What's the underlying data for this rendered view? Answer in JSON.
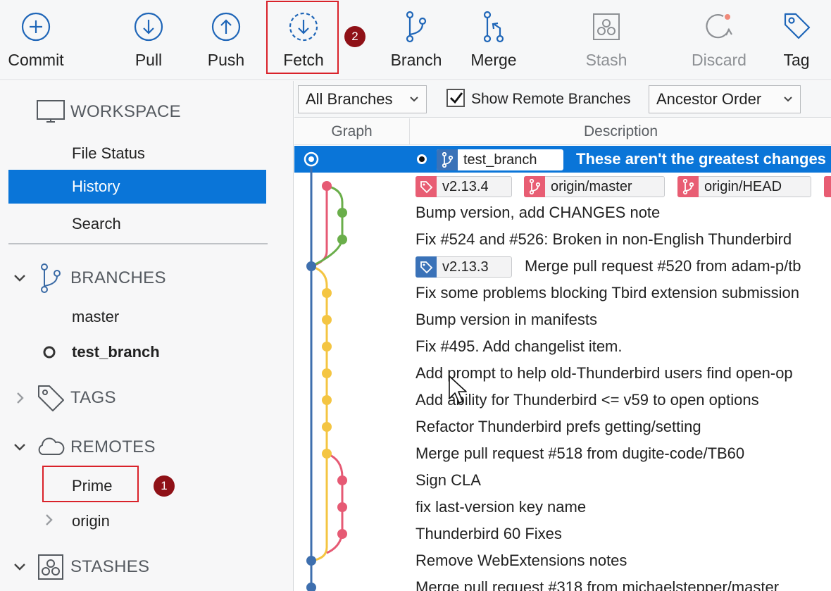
{
  "toolbar": {
    "buttons": [
      {
        "id": "commit",
        "label": "Commit",
        "icon": "plus-circle-icon",
        "enabled": true
      },
      {
        "id": "pull",
        "label": "Pull",
        "icon": "arrow-down-circle-icon",
        "enabled": true
      },
      {
        "id": "push",
        "label": "Push",
        "icon": "arrow-up-circle-icon",
        "enabled": true
      },
      {
        "id": "fetch",
        "label": "Fetch",
        "icon": "dashed-arrow-down-circle-icon",
        "enabled": true
      },
      {
        "id": "branch",
        "label": "Branch",
        "icon": "branch-icon",
        "enabled": true
      },
      {
        "id": "merge",
        "label": "Merge",
        "icon": "merge-icon",
        "enabled": true
      },
      {
        "id": "stash",
        "label": "Stash",
        "icon": "stash-icon",
        "enabled": false
      },
      {
        "id": "discard",
        "label": "Discard",
        "icon": "discard-icon",
        "enabled": false
      },
      {
        "id": "tag",
        "label": "Tag",
        "icon": "tag-icon",
        "enabled": true
      }
    ],
    "fetch_badge": "2"
  },
  "sidebar": {
    "workspace": {
      "title": "WORKSPACE",
      "items": [
        "File Status",
        "History",
        "Search"
      ],
      "selected": "History"
    },
    "branches": {
      "title": "BRANCHES",
      "items": [
        "master",
        "test_branch"
      ],
      "current": "test_branch"
    },
    "tags": {
      "title": "TAGS"
    },
    "remotes": {
      "title": "REMOTES",
      "items": [
        "Prime",
        "origin"
      ],
      "prime_badge": "1"
    },
    "stashes": {
      "title": "STASHES"
    }
  },
  "filters": {
    "branches_dropdown": "All Branches",
    "show_remote_label": "Show Remote Branches",
    "show_remote_checked": true,
    "order_dropdown": "Ancestor Order"
  },
  "columns": {
    "graph": "Graph",
    "description": "Description"
  },
  "commits": [
    {
      "message": "These aren't the greatest changes",
      "refs": [
        {
          "type": "branch",
          "label": "test_branch"
        }
      ],
      "selected": true
    },
    {
      "message": "",
      "refs": [
        {
          "type": "tag",
          "label": "v2.13.4"
        },
        {
          "type": "branch",
          "label": "origin/master"
        },
        {
          "type": "branch",
          "label": "origin/HEAD"
        }
      ]
    },
    {
      "message": "Bump version, add CHANGES note",
      "refs": []
    },
    {
      "message": "Fix #524 and #526: Broken in non-English Thunderbird",
      "refs": []
    },
    {
      "message": "Merge pull request #520 from adam-p/tb",
      "refs": [
        {
          "type": "tag",
          "label": "v2.13.3"
        }
      ]
    },
    {
      "message": "Fix some problems blocking Tbird extension submission",
      "refs": []
    },
    {
      "message": "Bump version in manifests",
      "refs": []
    },
    {
      "message": "Fix #495. Add changelist item.",
      "refs": []
    },
    {
      "message": "Add prompt to help old-Thunderbird users find open-op",
      "refs": []
    },
    {
      "message": "Add ability for Thunderbird <= v59 to open options",
      "refs": []
    },
    {
      "message": "Refactor Thunderbird prefs getting/setting",
      "refs": []
    },
    {
      "message": "Merge pull request #518 from dugite-code/TB60",
      "refs": []
    },
    {
      "message": "Sign CLA",
      "refs": []
    },
    {
      "message": "fix last-version key name",
      "refs": []
    },
    {
      "message": "Thunderbird 60 Fixes",
      "refs": []
    },
    {
      "message": "Remove WebExtensions notes",
      "refs": []
    },
    {
      "message": "Merge pull request #318 from michaelstepper/master",
      "refs": []
    }
  ],
  "colors": {
    "accent": "#0a75d8",
    "main_line": "#3e6fae",
    "pink": "#e65a74",
    "green": "#6aae4a",
    "yellow": "#f4c542",
    "tag_red": "#e85d73",
    "tag_blue": "#3a72b8",
    "branch_red": "#e85d73",
    "branch_blue": "#3a72b8",
    "highlight": "#d9222a"
  }
}
